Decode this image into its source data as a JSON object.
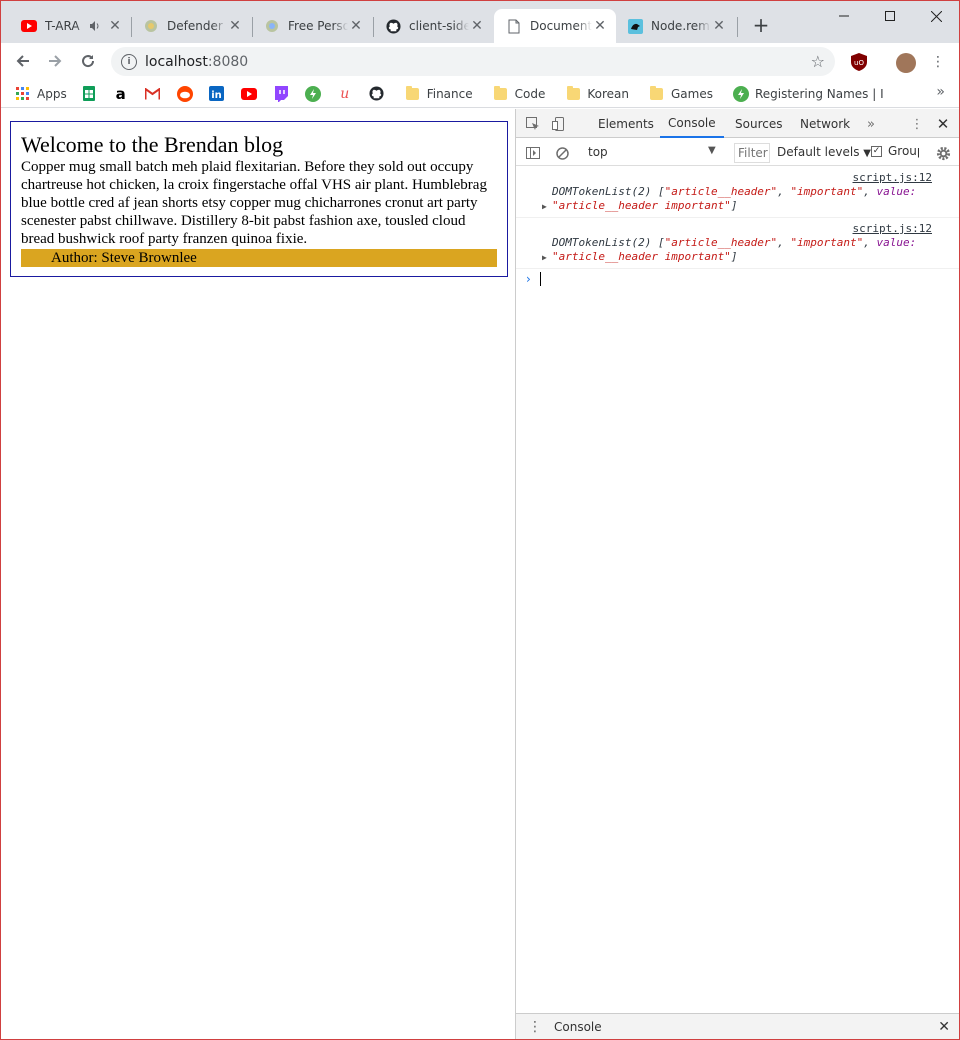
{
  "tabs": [
    {
      "title": "T-ARA",
      "icon": "youtube-icon",
      "audio": true
    },
    {
      "title": "Defender F",
      "icon": "defender-icon"
    },
    {
      "title": "Free Perso",
      "icon": "free-person-icon"
    },
    {
      "title": "client-side",
      "icon": "github-icon"
    },
    {
      "title": "Document",
      "icon": "document-icon",
      "active": true
    },
    {
      "title": "Node.remo",
      "icon": "node-icon"
    }
  ],
  "address": {
    "host": "localhost",
    "port": ":8080"
  },
  "bookmarks": [
    {
      "label": "Apps",
      "icon": "apps-grid-icon"
    },
    {
      "label": "",
      "icon": "sheets-icon"
    },
    {
      "label": "",
      "icon": "amazon-icon"
    },
    {
      "label": "",
      "icon": "gmail-icon"
    },
    {
      "label": "",
      "icon": "reddit-icon"
    },
    {
      "label": "",
      "icon": "linkedin-icon"
    },
    {
      "label": "",
      "icon": "youtube-icon"
    },
    {
      "label": "",
      "icon": "twitch-icon"
    },
    {
      "label": "",
      "icon": "bolt-icon"
    },
    {
      "label": "",
      "icon": "udemy-icon"
    },
    {
      "label": "",
      "icon": "github-icon"
    },
    {
      "label": "Finance",
      "icon": "folder-icon"
    },
    {
      "label": "Code",
      "icon": "folder-icon"
    },
    {
      "label": "Korean",
      "icon": "folder-icon"
    },
    {
      "label": "Games",
      "icon": "folder-icon"
    },
    {
      "label": "Registering Names | I",
      "icon": "bolt-icon"
    }
  ],
  "page": {
    "heading": "Welcome to the Brendan blog",
    "body": "Copper mug small batch meh plaid flexitarian. Before they sold out occupy chartreuse hot chicken, la croix fingerstache offal VHS air plant. Humblebrag blue bottle cred af jean shorts etsy copper mug chicharrones cronut art party scenester pabst chillwave. Distillery 8-bit pabst fashion axe, tousled cloud bread bushwick roof party franzen quinoa fixie.",
    "author": "Author: Steve Brownlee",
    "author_bg": "#daa520"
  },
  "devtools": {
    "tabs": [
      "Elements",
      "Console",
      "Sources",
      "Network"
    ],
    "active_tab": "Console",
    "context": "top",
    "filter_placeholder": "Filter",
    "levels": "Default levels",
    "group_label": "Group similar",
    "messages": [
      {
        "source": "script.js:12",
        "type": "DOMTokenList(2)",
        "items": [
          "\"article__header\"",
          "\"important\""
        ],
        "value_key": "value:",
        "value": "\"article__header important\""
      },
      {
        "source": "script.js:12",
        "type": "DOMTokenList(2)",
        "items": [
          "\"article__header\"",
          "\"important\""
        ],
        "value_key": "value:",
        "value": "\"article__header important\""
      }
    ],
    "drawer_tab": "Console"
  }
}
